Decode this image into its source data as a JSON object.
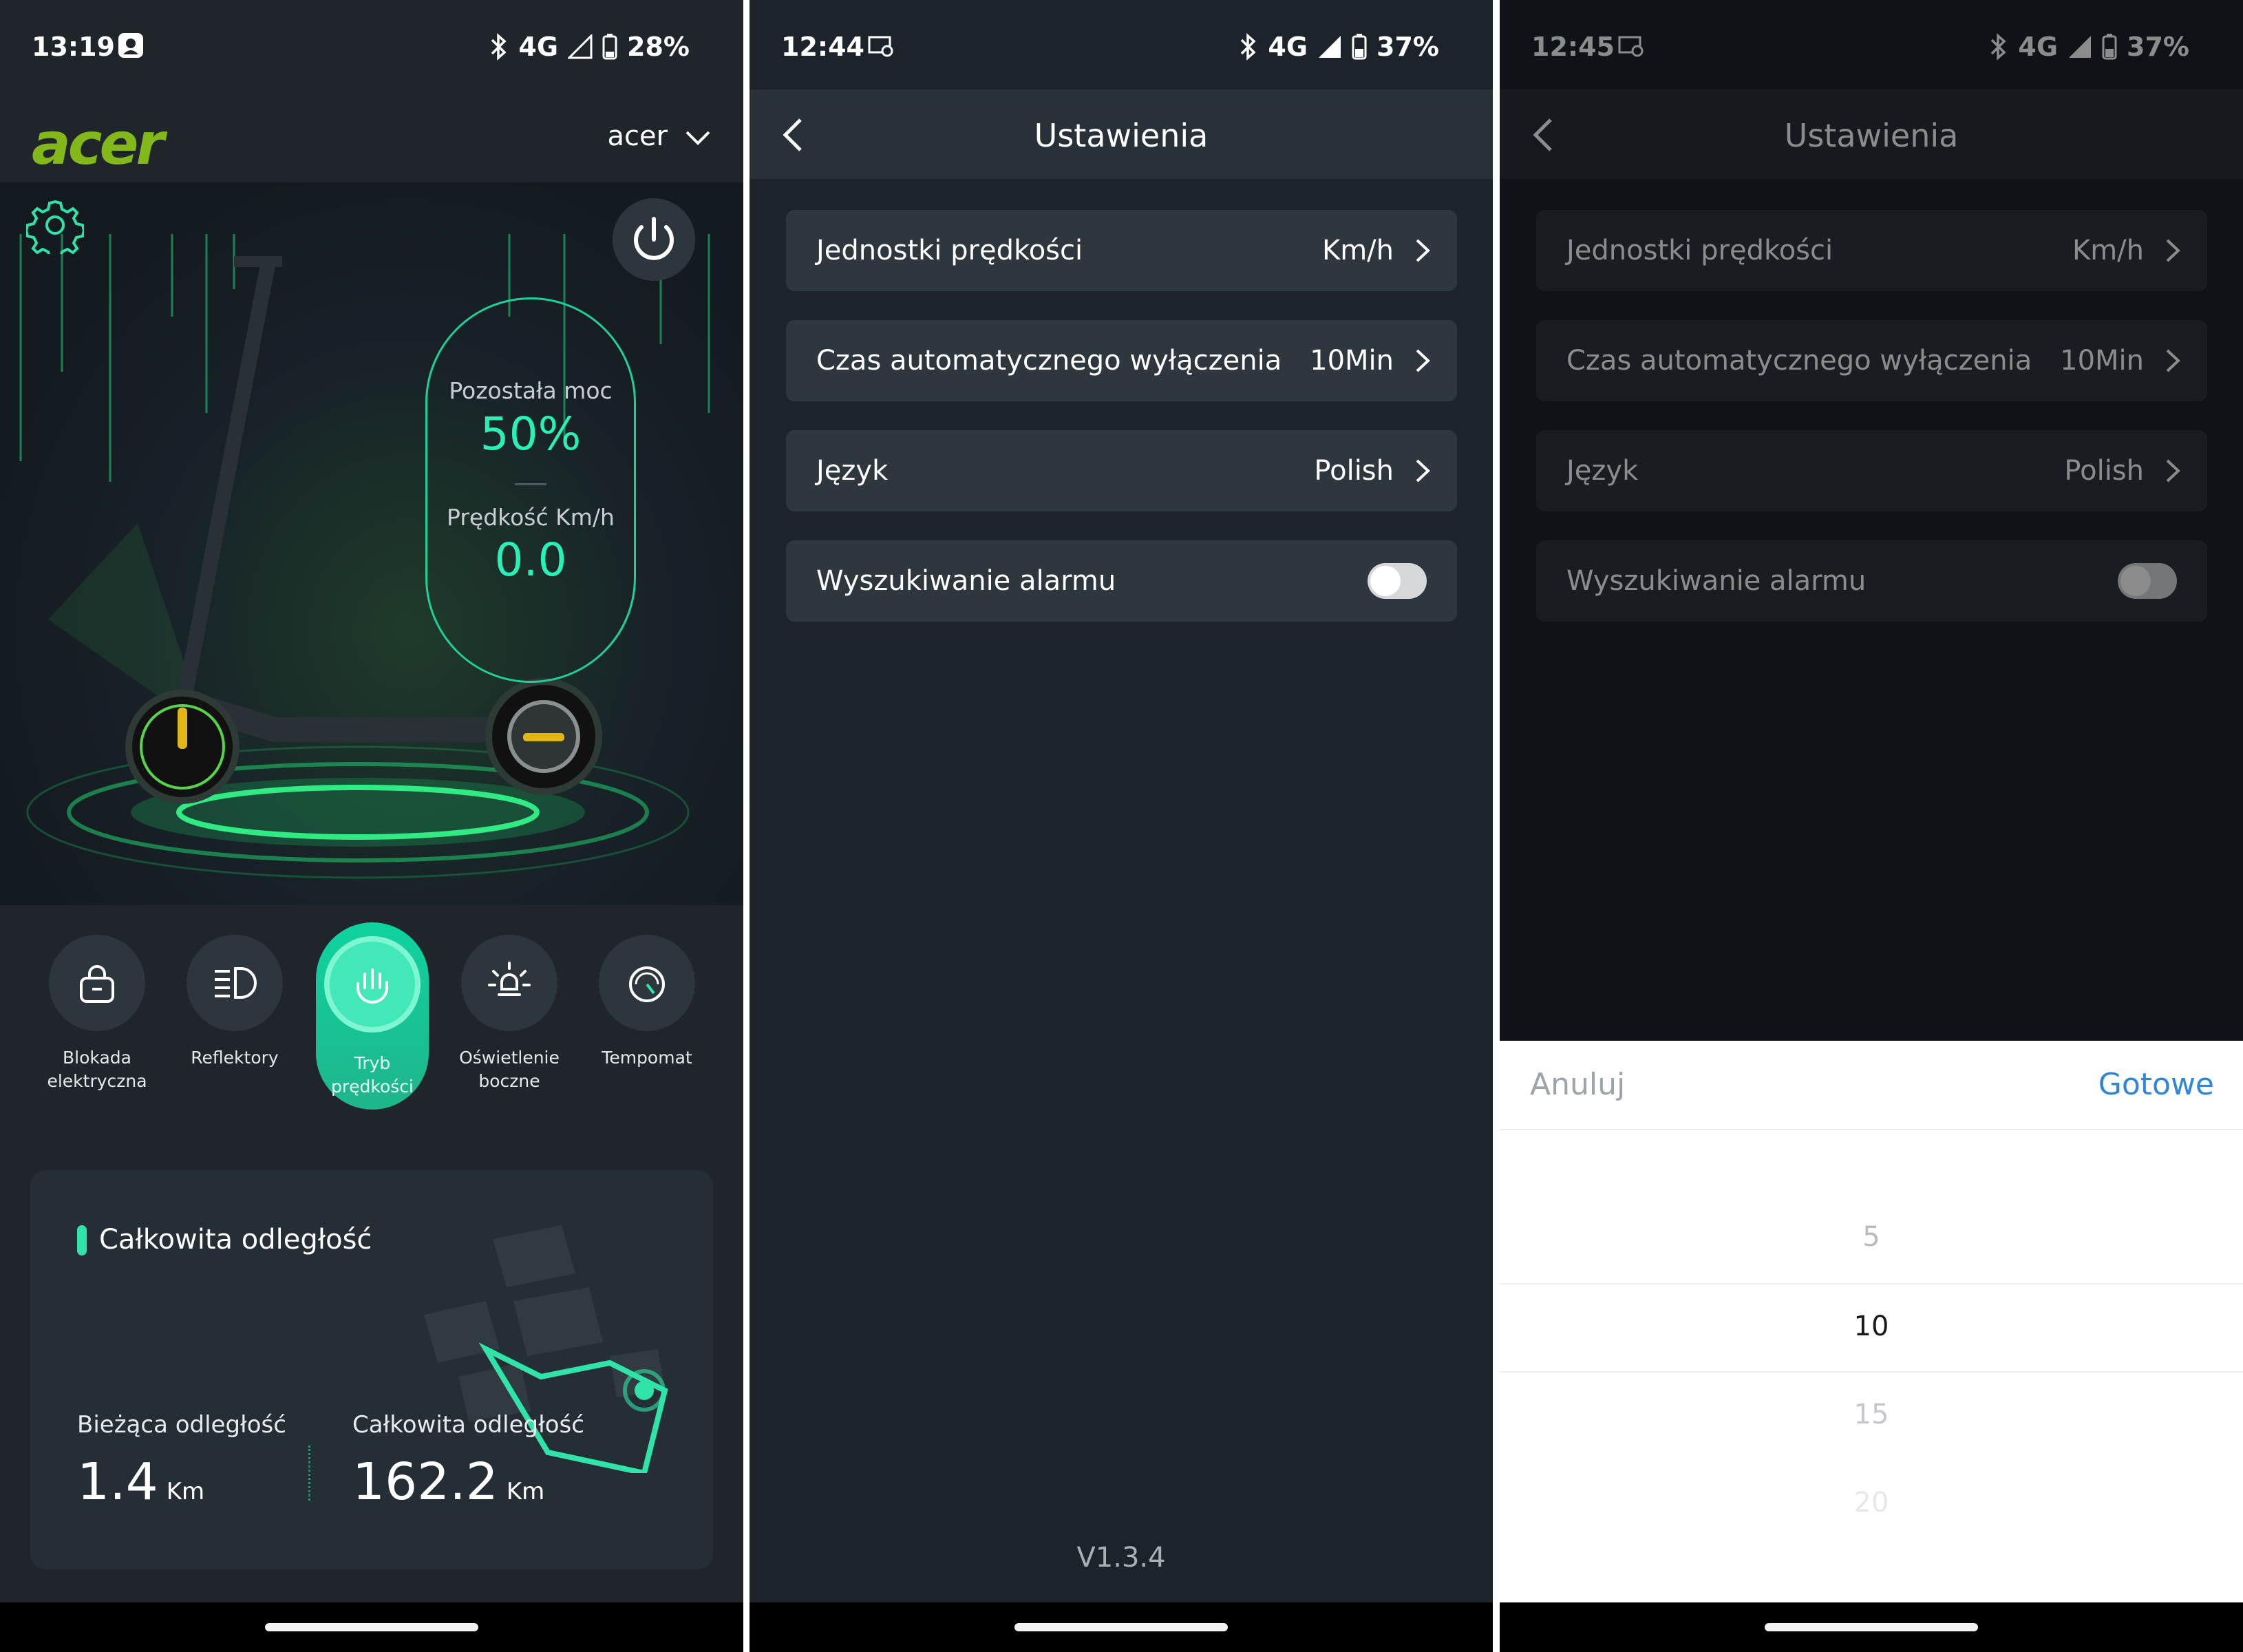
{
  "screens": [
    {
      "status": {
        "time": "13:19",
        "network": "4G",
        "battery": "28%"
      },
      "brand": "acer",
      "device": "acer",
      "battery_label": "Pozostała moc",
      "battery_value": "50%",
      "battery_level_fraction": 0.5,
      "speed_label": "Prędkość Km/h",
      "speed_value": "0.0",
      "controls": [
        {
          "label_line1": "Blokada",
          "label_line2": "elektryczna",
          "icon": "lock-icon",
          "active": false
        },
        {
          "label_line1": "Reflektory",
          "label_line2": "",
          "icon": "headlight-icon",
          "active": false
        },
        {
          "label_line1": "Tryb",
          "label_line2": "prędkości",
          "icon": "speed-mode-icon",
          "active": true
        },
        {
          "label_line1": "Oświetlenie",
          "label_line2": "boczne",
          "icon": "side-light-icon",
          "active": false
        },
        {
          "label_line1": "Tempomat",
          "label_line2": "",
          "icon": "cruise-control-icon",
          "active": false
        }
      ],
      "distance": {
        "title": "Całkowita odległość",
        "current_label": "Bieżąca odległość",
        "current_value": "1.4",
        "current_unit": "Km",
        "total_label": "Całkowita odległość",
        "total_value": "162.2",
        "total_unit": "Km"
      },
      "colors": {
        "accent": "#29f0b6",
        "brand": "#83b81a"
      }
    },
    {
      "status": {
        "time": "12:44",
        "network": "4G",
        "battery": "37%"
      },
      "title": "Ustawienia",
      "rows": [
        {
          "label": "Jednostki prędkości",
          "value": "Km/h"
        },
        {
          "label": "Czas automatycznego wyłączenia",
          "value": "10Min"
        },
        {
          "label": "Język",
          "value": "Polish"
        },
        {
          "label": "Wyszukiwanie alarmu",
          "toggle": false
        }
      ],
      "version": "V1.3.4"
    },
    {
      "status": {
        "time": "12:45",
        "network": "4G",
        "battery": "37%"
      },
      "title": "Ustawienia",
      "rows": [
        {
          "label": "Jednostki prędkości",
          "value": "Km/h"
        },
        {
          "label": "Czas automatycznego wyłączenia",
          "value": "10Min"
        },
        {
          "label": "Język",
          "value": "Polish"
        },
        {
          "label": "Wyszukiwanie alarmu",
          "toggle": false
        }
      ],
      "picker": {
        "cancel": "Anuluj",
        "done": "Gotowe",
        "options": [
          "5",
          "10",
          "15",
          "20"
        ],
        "selected": "10"
      }
    }
  ]
}
